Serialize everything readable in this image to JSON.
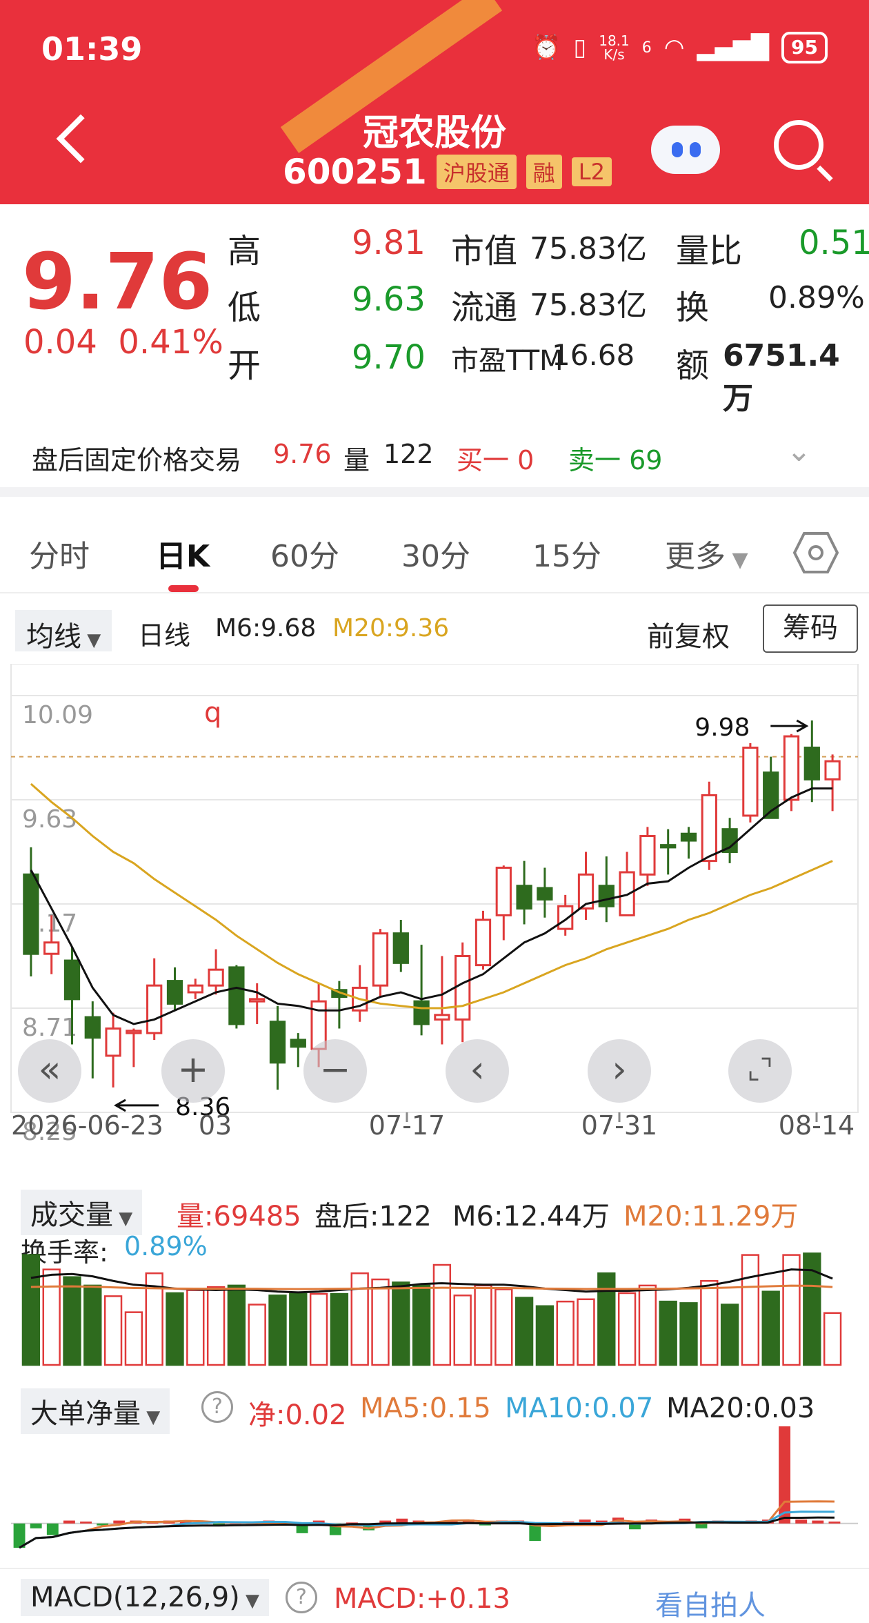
{
  "status_bar": {
    "time": "01:39",
    "net_speed_value": "18.1",
    "net_speed_unit": "K/s",
    "signal_note": "6",
    "battery": "95"
  },
  "header": {
    "name": "冠农股份",
    "code": "600251",
    "tags": [
      "沪股通",
      "融",
      "L2"
    ]
  },
  "quote": {
    "price": "9.76",
    "change": "0.04",
    "change_pct": "0.41%",
    "high_label": "高",
    "high": "9.81",
    "low_label": "低",
    "low": "9.63",
    "open_label": "开",
    "open": "9.70",
    "mktcap_label": "市值",
    "mktcap": "75.83亿",
    "float_label": "流通",
    "float": "75.83亿",
    "pe_label": "市盈TTM",
    "pe": "16.68",
    "volratio_label": "量比",
    "volratio": "0.51",
    "turnover_label": "换",
    "turnover": "0.89%",
    "amount_label": "额",
    "amount": "6751.4万"
  },
  "after_hours": {
    "label": "盘后固定价格交易",
    "price": "9.76",
    "vol_label": "量",
    "vol": "122",
    "buy1": "买一 0",
    "sell1": "卖一 69"
  },
  "tabs": [
    "分时",
    "日K",
    "60分",
    "30分",
    "15分",
    "更多"
  ],
  "controls": {
    "ma_select": "均线",
    "period": "日线",
    "m6": "M6:9.68",
    "m20": "M20:9.36",
    "adjust": "前复权",
    "chips": "筹码"
  },
  "colors": {
    "up": "#e03a3a",
    "down": "#2e6b1e",
    "ma6": "#111111",
    "ma20": "#d9a520",
    "header": "#e9303c"
  },
  "chart_data": {
    "type": "candlestick",
    "y_ticks": [
      "10.09",
      "9.63",
      "9.17",
      "8.71",
      "8.25"
    ],
    "ylim": [
      8.25,
      10.09
    ],
    "x_labels": [
      "2026-06-23",
      "03",
      "07-17",
      "07-31",
      "08-14"
    ],
    "hi_annot": "9.98",
    "lo_annot": "8.36",
    "mark_label": "q",
    "candles": [
      [
        9.3,
        8.95,
        9.42,
        8.85
      ],
      [
        8.95,
        9.0,
        9.12,
        8.86
      ],
      [
        8.92,
        8.75,
        8.98,
        8.55
      ],
      [
        8.67,
        8.58,
        8.74,
        8.4
      ],
      [
        8.5,
        8.62,
        8.69,
        8.36
      ],
      [
        8.6,
        8.61,
        8.62,
        8.45
      ],
      [
        8.6,
        8.81,
        8.93,
        8.57
      ],
      [
        8.83,
        8.73,
        8.89,
        8.7
      ],
      [
        8.78,
        8.81,
        8.84,
        8.75
      ],
      [
        8.81,
        8.88,
        8.97,
        8.77
      ],
      [
        8.89,
        8.64,
        8.9,
        8.62
      ],
      [
        8.74,
        8.75,
        8.82,
        8.64
      ],
      [
        8.65,
        8.47,
        8.72,
        8.35
      ],
      [
        8.57,
        8.54,
        8.6,
        8.45
      ],
      [
        8.53,
        8.74,
        8.82,
        8.45
      ],
      [
        8.79,
        8.76,
        8.83,
        8.62
      ],
      [
        8.7,
        8.8,
        8.9,
        8.65
      ],
      [
        8.81,
        9.04,
        9.06,
        8.76
      ],
      [
        9.04,
        8.91,
        9.1,
        8.87
      ],
      [
        8.74,
        8.64,
        8.99,
        8.59
      ],
      [
        8.66,
        8.68,
        8.94,
        8.55
      ],
      [
        8.66,
        8.94,
        9.0,
        8.56
      ],
      [
        8.9,
        9.1,
        9.14,
        8.88
      ],
      [
        9.12,
        9.33,
        9.34,
        9.01
      ],
      [
        9.25,
        9.15,
        9.36,
        9.08
      ],
      [
        9.24,
        9.19,
        9.33,
        9.11
      ],
      [
        9.06,
        9.16,
        9.21,
        9.03
      ],
      [
        9.15,
        9.3,
        9.4,
        9.1
      ],
      [
        9.25,
        9.16,
        9.38,
        9.09
      ],
      [
        9.12,
        9.31,
        9.4,
        9.12
      ],
      [
        9.3,
        9.47,
        9.51,
        9.25
      ],
      [
        9.43,
        9.42,
        9.5,
        9.3
      ],
      [
        9.48,
        9.45,
        9.51,
        9.37
      ],
      [
        9.36,
        9.65,
        9.71,
        9.32
      ],
      [
        9.5,
        9.4,
        9.55,
        9.35
      ],
      [
        9.56,
        9.86,
        9.88,
        9.53
      ],
      [
        9.75,
        9.55,
        9.82,
        9.55
      ],
      [
        9.63,
        9.91,
        9.92,
        9.58
      ],
      [
        9.86,
        9.72,
        9.98,
        9.62
      ],
      [
        9.72,
        9.8,
        9.83,
        9.58
      ]
    ],
    "ma6_line": [
      9.32,
      9.15,
      8.98,
      8.8,
      8.68,
      8.64,
      8.66,
      8.7,
      8.74,
      8.78,
      8.8,
      8.78,
      8.73,
      8.72,
      8.7,
      8.7,
      8.72,
      8.76,
      8.78,
      8.75,
      8.77,
      8.82,
      8.86,
      8.93,
      9.0,
      9.04,
      9.1,
      9.17,
      9.19,
      9.21,
      9.26,
      9.27,
      9.33,
      9.38,
      9.42,
      9.5,
      9.58,
      9.64,
      9.68,
      9.68
    ],
    "ma20_line": [
      9.7,
      9.62,
      9.55,
      9.47,
      9.4,
      9.35,
      9.28,
      9.22,
      9.16,
      9.1,
      9.03,
      8.97,
      8.91,
      8.86,
      8.82,
      8.78,
      8.75,
      8.73,
      8.72,
      8.71,
      8.71,
      8.72,
      8.75,
      8.78,
      8.82,
      8.86,
      8.9,
      8.93,
      8.97,
      9.0,
      9.03,
      9.06,
      9.1,
      9.13,
      9.17,
      9.21,
      9.24,
      9.28,
      9.32,
      9.36
    ],
    "volume_header": {
      "select": "成交量",
      "vol": "量:69485",
      "after": "盘后:122",
      "m6": "M6:12.44万",
      "m20": "M20:11.29万",
      "turnover_label": "换手率:",
      "turnover": "0.89%"
    },
    "volume": [
      14.4,
      12.5,
      11.5,
      10.4,
      9.0,
      6.9,
      12.0,
      9.4,
      9.8,
      10.2,
      10.4,
      7.9,
      9.1,
      9.3,
      9.3,
      9.3,
      12.0,
      11.2,
      10.8,
      10.4,
      13.1,
      9.1,
      10.4,
      9.9,
      8.8,
      7.7,
      8.3,
      8.6,
      12.0,
      9.4,
      10.4,
      8.3,
      8.1,
      11.0,
      7.9,
      14.4,
      9.6,
      14.4,
      14.6,
      6.8
    ],
    "volume_ma": [
      11.4,
      11.8,
      11.9,
      11.6,
      11.0,
      10.5,
      10.3,
      10.0,
      9.9,
      9.8,
      9.9,
      9.8,
      9.6,
      9.5,
      9.6,
      9.8,
      10.0,
      10.1,
      10.3,
      10.6,
      10.7,
      10.6,
      10.5,
      10.5,
      10.3,
      10.0,
      9.8,
      9.6,
      9.7,
      9.7,
      9.8,
      9.9,
      10.1,
      10.4,
      10.9,
      11.5,
      12.0,
      12.5,
      12.4,
      11.3
    ],
    "volume_ylim": [
      0,
      15
    ],
    "bigorder_header": {
      "select": "大单净量",
      "net": "净:0.02",
      "ma5": "MA5:0.15",
      "ma10": "MA10:0.07",
      "ma20": "MA20:0.03"
    },
    "bigorder": [
      -0.25,
      -0.05,
      -0.12,
      0.03,
      0.02,
      -0.02,
      0.03,
      0.03,
      0.02,
      0.03,
      0.02,
      0.01,
      -0.02,
      0.01,
      0.01,
      0.03,
      0.02,
      -0.1,
      0.03,
      -0.12,
      0.01,
      -0.07,
      0.03,
      0.05,
      0.03,
      0.02,
      0.02,
      0.04,
      -0.02,
      0.03,
      0.03,
      -0.18,
      0.01,
      0.02,
      0.04,
      0.03,
      0.06,
      -0.06,
      0.04,
      0.02,
      0.05,
      -0.05,
      0.03,
      0.02,
      0.03,
      0.04,
      1.0,
      0.04,
      0.03,
      0.02
    ],
    "bigorder_ylim": [
      -0.3,
      1.05
    ],
    "macd_header": {
      "select": "MACD(12,26,9)",
      "macd": "MACD:+0.13"
    }
  },
  "watermark": "看自拍人"
}
